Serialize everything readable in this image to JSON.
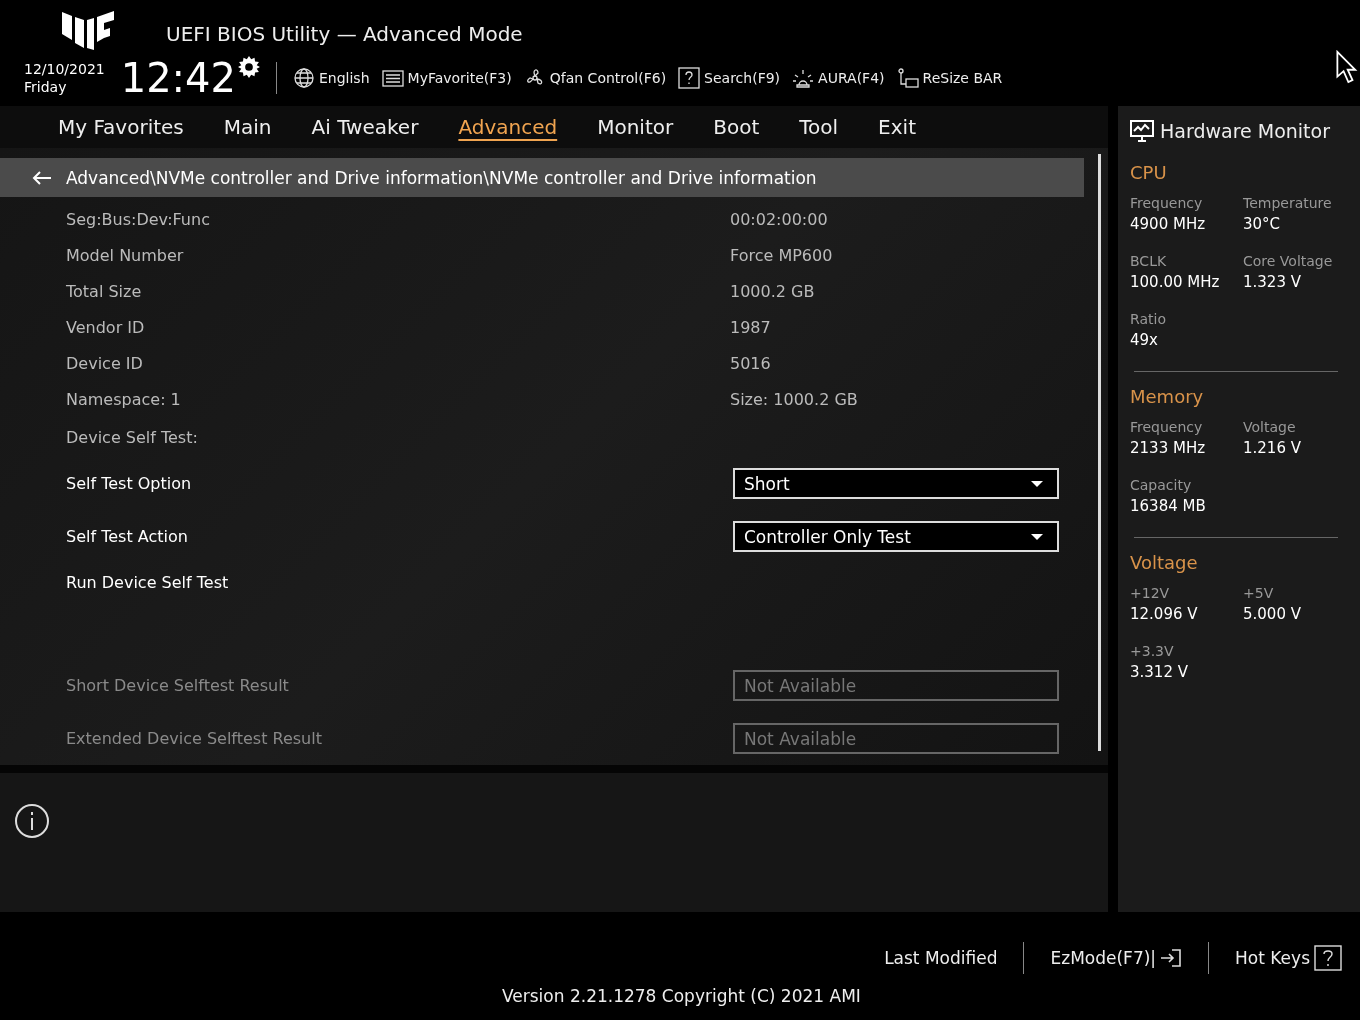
{
  "header": {
    "title": "UEFI BIOS Utility — Advanced Mode",
    "date": "12/10/2021",
    "day": "Friday",
    "time": "12:42",
    "toolbar": [
      {
        "label": "English"
      },
      {
        "label": "MyFavorite(F3)"
      },
      {
        "label": "Qfan Control(F6)"
      },
      {
        "label": "Search(F9)"
      },
      {
        "label": "AURA(F4)"
      },
      {
        "label": "ReSize BAR"
      }
    ]
  },
  "tabs": [
    {
      "label": "My Favorites",
      "selected": false
    },
    {
      "label": "Main",
      "selected": false
    },
    {
      "label": "Ai Tweaker",
      "selected": false
    },
    {
      "label": "Advanced",
      "selected": true
    },
    {
      "label": "Monitor",
      "selected": false
    },
    {
      "label": "Boot",
      "selected": false
    },
    {
      "label": "Tool",
      "selected": false
    },
    {
      "label": "Exit",
      "selected": false
    }
  ],
  "breadcrumb": "Advanced\\NVMe controller and Drive information\\NVMe controller and Drive information",
  "rows": [
    {
      "kind": "info",
      "label": "Seg:Bus:Dev:Func",
      "value": "00:02:00:00"
    },
    {
      "kind": "info",
      "label": "Model Number",
      "value": "Force MP600"
    },
    {
      "kind": "info",
      "label": "Total Size",
      "value": "1000.2 GB"
    },
    {
      "kind": "info",
      "label": "Vendor ID",
      "value": "1987"
    },
    {
      "kind": "info",
      "label": "Device ID",
      "value": "5016"
    },
    {
      "kind": "info",
      "label": "Namespace: 1",
      "value": "Size: 1000.2 GB"
    },
    {
      "kind": "section",
      "label": "Device Self Test:"
    },
    {
      "kind": "dropdown",
      "label": "Self Test Option",
      "value": "Short"
    },
    {
      "kind": "dropdown",
      "label": "Self Test Action",
      "value": "Controller Only Test"
    },
    {
      "kind": "action",
      "label": "Run Device Self Test"
    },
    {
      "kind": "result",
      "label": "Short Device Selftest Result",
      "value": "Not Available"
    },
    {
      "kind": "result",
      "label": "Extended Device Selftest Result",
      "value": "Not Available"
    }
  ],
  "monitor": {
    "title": "Hardware Monitor",
    "sections": [
      {
        "title": "CPU",
        "items": [
          {
            "label": "Frequency",
            "value": "4900 MHz"
          },
          {
            "label": "Temperature",
            "value": "30°C"
          },
          {
            "label": "BCLK",
            "value": "100.00 MHz"
          },
          {
            "label": "Core Voltage",
            "value": "1.323 V"
          },
          {
            "label": "Ratio",
            "value": "49x"
          }
        ]
      },
      {
        "title": "Memory",
        "items": [
          {
            "label": "Frequency",
            "value": "2133 MHz"
          },
          {
            "label": "Voltage",
            "value": "1.216 V"
          },
          {
            "label": "Capacity",
            "value": "16384 MB"
          }
        ]
      },
      {
        "title": "Voltage",
        "items": [
          {
            "label": "+12V",
            "value": "12.096 V"
          },
          {
            "label": "+5V",
            "value": "5.000 V"
          },
          {
            "label": "+3.3V",
            "value": "3.312 V"
          }
        ]
      }
    ]
  },
  "footer": {
    "buttons": [
      {
        "label": "Last Modified"
      },
      {
        "label": "EzMode(F7)|"
      },
      {
        "label": "Hot Keys"
      }
    ],
    "version": "Version 2.21.1278 Copyright (C) 2021 AMI"
  }
}
